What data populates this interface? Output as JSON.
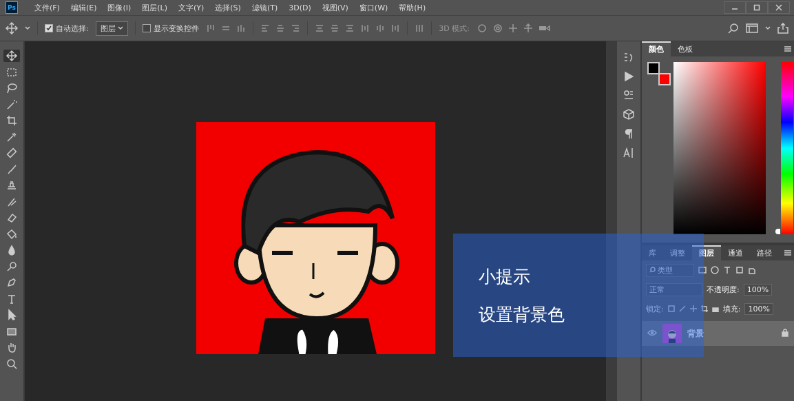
{
  "window": {
    "app_icon": "Ps",
    "menu": [
      "文件(F)",
      "编辑(E)",
      "图像(I)",
      "图层(L)",
      "文字(Y)",
      "选择(S)",
      "滤镜(T)",
      "3D(D)",
      "视图(V)",
      "窗口(W)",
      "帮助(H)"
    ]
  },
  "options_bar": {
    "auto_select": {
      "label": "自动选择:",
      "checked": true
    },
    "auto_select_target": "图层",
    "show_transform": {
      "label": "显示变换控件",
      "checked": false
    },
    "mode_label": "3D 模式:"
  },
  "tools": [
    {
      "kind": "move",
      "selected": true
    },
    {
      "kind": "marquee",
      "selected": false
    },
    {
      "kind": "lasso",
      "selected": false
    },
    {
      "kind": "wand",
      "selected": false
    },
    {
      "kind": "crop",
      "selected": false
    },
    {
      "kind": "eyedropper",
      "selected": false
    },
    {
      "kind": "heal",
      "selected": false
    },
    {
      "kind": "brush",
      "selected": false
    },
    {
      "kind": "stamp",
      "selected": false
    },
    {
      "kind": "history",
      "selected": false
    },
    {
      "kind": "eraser",
      "selected": false
    },
    {
      "kind": "bucket",
      "selected": false
    },
    {
      "kind": "blur",
      "selected": false
    },
    {
      "kind": "dodge",
      "selected": false
    },
    {
      "kind": "pen",
      "selected": false
    },
    {
      "kind": "type",
      "selected": false
    },
    {
      "kind": "select",
      "selected": false
    },
    {
      "kind": "rect",
      "selected": false
    },
    {
      "kind": "hand",
      "selected": false
    },
    {
      "kind": "zoom",
      "selected": false
    }
  ],
  "color_panel": {
    "tabs": [
      {
        "label": "颜色",
        "selected": true
      },
      {
        "label": "色板",
        "selected": false
      }
    ],
    "swatches": [
      {
        "color": "#000000"
      },
      {
        "color": "#ff0000"
      }
    ],
    "hue_slider": {
      "level": 0
    }
  },
  "layers_panel": {
    "tabs": [
      {
        "label": "库",
        "selected": false
      },
      {
        "label": "调整",
        "selected": false
      },
      {
        "label": "图层",
        "selected": true
      },
      {
        "label": "通道",
        "selected": false
      },
      {
        "label": "路径",
        "selected": false
      }
    ],
    "filter_placeholder": "类型",
    "blend_mode": "正常",
    "opacity_label": "不透明度:",
    "opacity": "100%",
    "lock_label": "锁定:",
    "fill_label": "填充:",
    "fill": "100%",
    "layers": [
      {
        "name": "背景",
        "visible": true,
        "locked": true,
        "selected": true
      }
    ]
  },
  "tip": {
    "title": "小提示",
    "text": "设置背景色"
  }
}
